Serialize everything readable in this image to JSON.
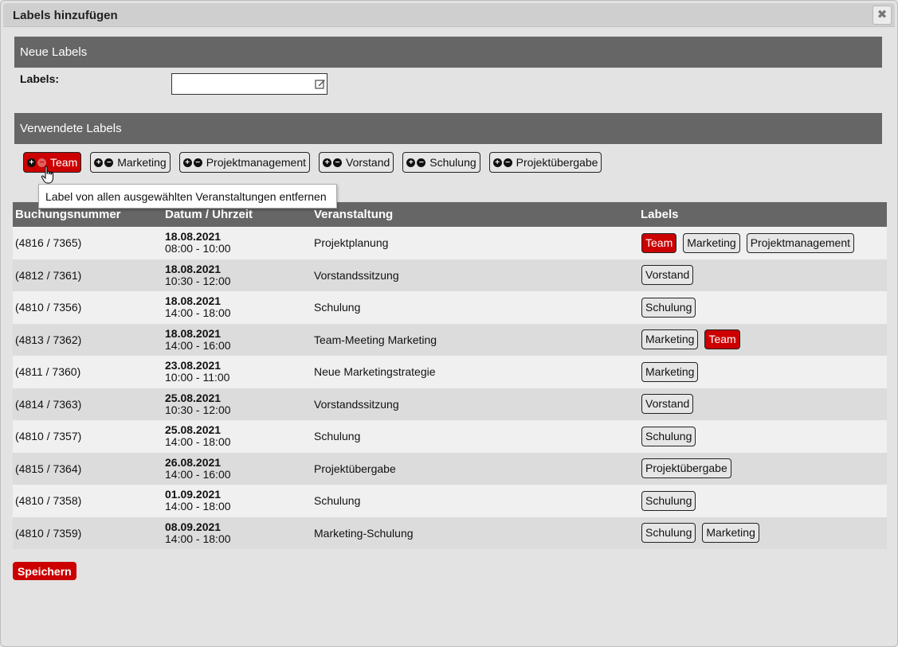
{
  "dialog": {
    "title": "Labels hinzufügen",
    "close_symbol": "✖"
  },
  "new_labels": {
    "heading": "Neue Labels",
    "field_label": "Labels:",
    "input_value": "",
    "input_placeholder": ""
  },
  "used_labels": {
    "heading": "Verwendete Labels",
    "items": [
      {
        "label": "Team",
        "active": true
      },
      {
        "label": "Marketing",
        "active": false
      },
      {
        "label": "Projektmanagement",
        "active": false
      },
      {
        "label": "Vorstand",
        "active": false
      },
      {
        "label": "Schulung",
        "active": false
      },
      {
        "label": "Projektübergabe",
        "active": false
      }
    ],
    "tooltip": "Label von allen ausgewählten Veranstaltungen entfernen"
  },
  "table": {
    "headers": [
      "Buchungsnummer",
      "Datum / Uhrzeit",
      "Veranstaltung",
      "Labels"
    ],
    "rows": [
      {
        "booking": "(4816 / 7365)",
        "date": "18.08.2021",
        "time": "08:00 - 10:00",
        "event": "Projektplanung",
        "labels": [
          {
            "text": "Team",
            "red": true
          },
          {
            "text": "Marketing",
            "red": false
          },
          {
            "text": "Projektmanagement",
            "red": false
          }
        ]
      },
      {
        "booking": "(4812 / 7361)",
        "date": "18.08.2021",
        "time": "10:30 - 12:00",
        "event": "Vorstandssitzung",
        "labels": [
          {
            "text": "Vorstand",
            "red": false
          }
        ]
      },
      {
        "booking": "(4810 / 7356)",
        "date": "18.08.2021",
        "time": "14:00 - 18:00",
        "event": "Schulung",
        "labels": [
          {
            "text": "Schulung",
            "red": false
          }
        ]
      },
      {
        "booking": "(4813 / 7362)",
        "date": "18.08.2021",
        "time": "14:00 - 16:00",
        "event": "Team-Meeting Marketing",
        "labels": [
          {
            "text": "Marketing",
            "red": false
          },
          {
            "text": "Team",
            "red": true
          }
        ]
      },
      {
        "booking": "(4811 / 7360)",
        "date": "23.08.2021",
        "time": "10:00 - 11:00",
        "event": "Neue Marketingstrategie",
        "labels": [
          {
            "text": "Marketing",
            "red": false
          }
        ]
      },
      {
        "booking": "(4814 / 7363)",
        "date": "25.08.2021",
        "time": "10:30 - 12:00",
        "event": "Vorstandssitzung",
        "labels": [
          {
            "text": "Vorstand",
            "red": false
          }
        ]
      },
      {
        "booking": "(4810 / 7357)",
        "date": "25.08.2021",
        "time": "14:00 - 18:00",
        "event": "Schulung",
        "labels": [
          {
            "text": "Schulung",
            "red": false
          }
        ]
      },
      {
        "booking": "(4815 / 7364)",
        "date": "26.08.2021",
        "time": "14:00 - 16:00",
        "event": "Projektübergabe",
        "labels": [
          {
            "text": "Projektübergabe",
            "red": false
          }
        ]
      },
      {
        "booking": "(4810 / 7358)",
        "date": "01.09.2021",
        "time": "14:00 - 18:00",
        "event": "Schulung",
        "labels": [
          {
            "text": "Schulung",
            "red": false
          }
        ]
      },
      {
        "booking": "(4810 / 7359)",
        "date": "08.09.2021",
        "time": "14:00 - 18:00",
        "event": "Marketing-Schulung",
        "labels": [
          {
            "text": "Schulung",
            "red": false
          },
          {
            "text": "Marketing",
            "red": false
          }
        ]
      }
    ]
  },
  "save_label": "Speichern",
  "colors": {
    "accent_red": "#cc0000",
    "header_gray": "#666666"
  }
}
